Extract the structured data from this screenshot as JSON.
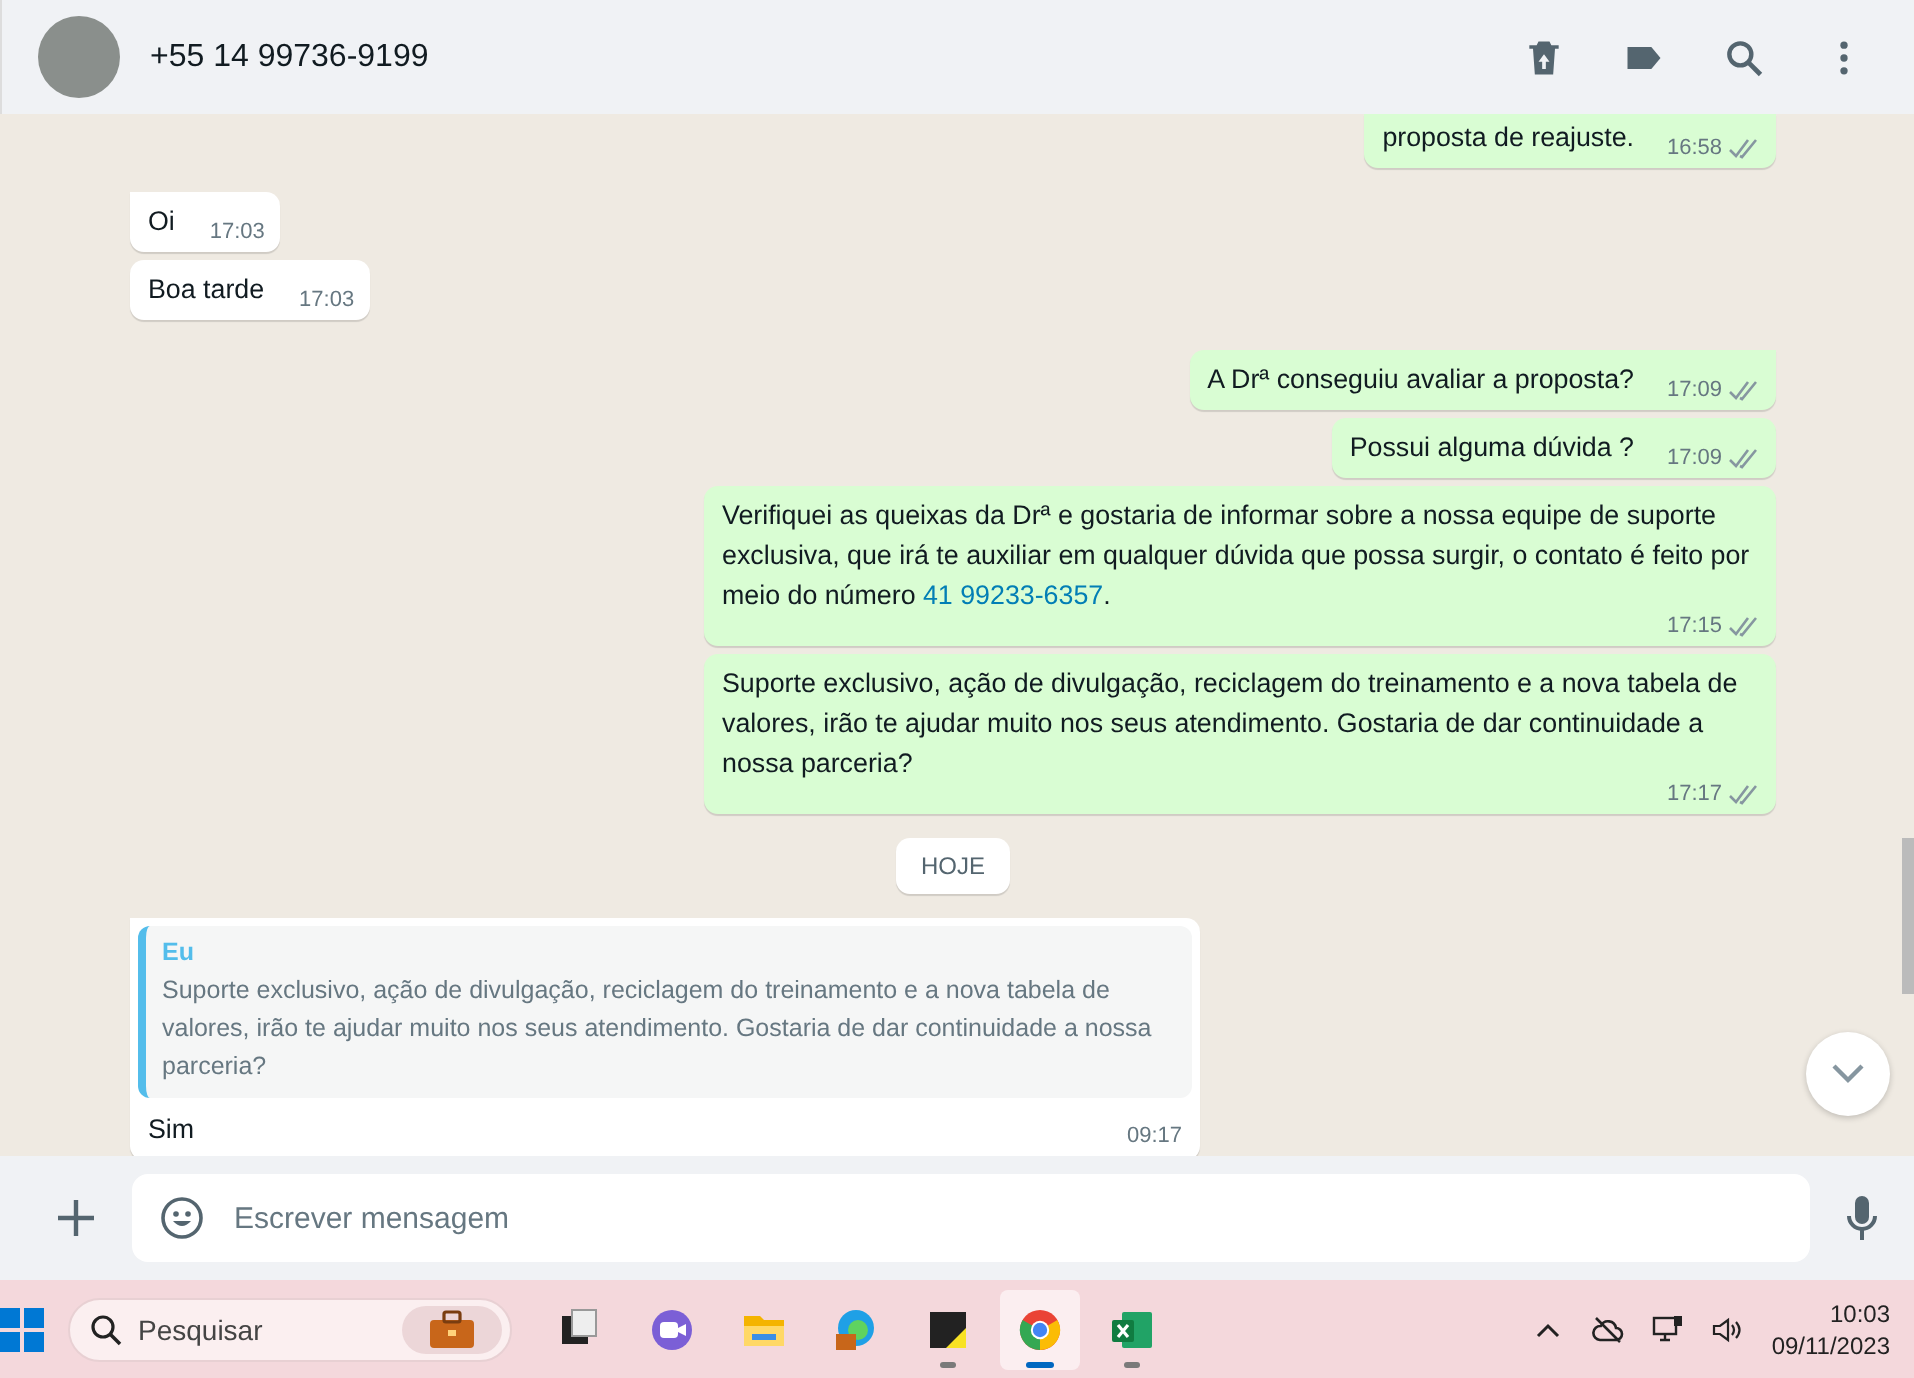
{
  "header": {
    "contact": "+55 14 99736-9199"
  },
  "messages": [
    {
      "kind": "outgoing",
      "text": "proposta de reajuste.",
      "time": "16:58"
    },
    {
      "kind": "incoming",
      "text": "Oi",
      "time": "17:03",
      "tail": true
    },
    {
      "kind": "incoming",
      "text": "Boa tarde",
      "time": "17:03",
      "tail": false
    },
    {
      "kind": "outgoing",
      "text": "A Drª conseguiu avaliar a proposta?",
      "time": "17:09",
      "tail": true
    },
    {
      "kind": "outgoing",
      "text": "Possui alguma dúvida ?",
      "time": "17:09",
      "tail": false
    },
    {
      "kind": "outgoing",
      "text": "Verifiquei as queixas da Drª e gostaria de informar sobre a nossa equipe de suporte exclusiva, que irá te auxiliar em qualquer dúvida que possa surgir, o contato é feito por meio do número ",
      "link": "41 99233-6357",
      "after": ".",
      "time": "17:15",
      "tail": false
    },
    {
      "kind": "outgoing",
      "text": "Suporte exclusivo, ação de divulgação, reciclagem do treinamento e a nova tabela de valores, irão te ajudar muito nos seus atendimento. Gostaria de dar continuidade a nossa parceria?",
      "time": "17:17",
      "tail": false
    },
    {
      "kind": "date",
      "text": "HOJE"
    },
    {
      "kind": "reply",
      "quote_author": "Eu",
      "quote_text": "Suporte exclusivo, ação de divulgação, reciclagem do treinamento e a nova tabela de valores, irão te ajudar muito nos seus atendimento. Gostaria de dar continuidade a nossa parceria?",
      "text": "Sim",
      "time": "09:17",
      "tail": true
    }
  ],
  "composer": {
    "placeholder": "Escrever mensagem"
  },
  "taskbar": {
    "search_placeholder": "Pesquisar",
    "apps": [
      {
        "kind": "files",
        "running": false,
        "selected": false
      },
      {
        "kind": "meet",
        "running": false,
        "selected": false
      },
      {
        "kind": "folder",
        "running": false,
        "selected": false
      },
      {
        "kind": "edge",
        "running": false,
        "selected": false
      },
      {
        "kind": "notes",
        "running": true,
        "selected": false
      },
      {
        "kind": "chrome",
        "running": true,
        "selected": true
      },
      {
        "kind": "excel",
        "running": true,
        "selected": false
      }
    ],
    "time": "10:03",
    "date": "09/11/2023"
  }
}
